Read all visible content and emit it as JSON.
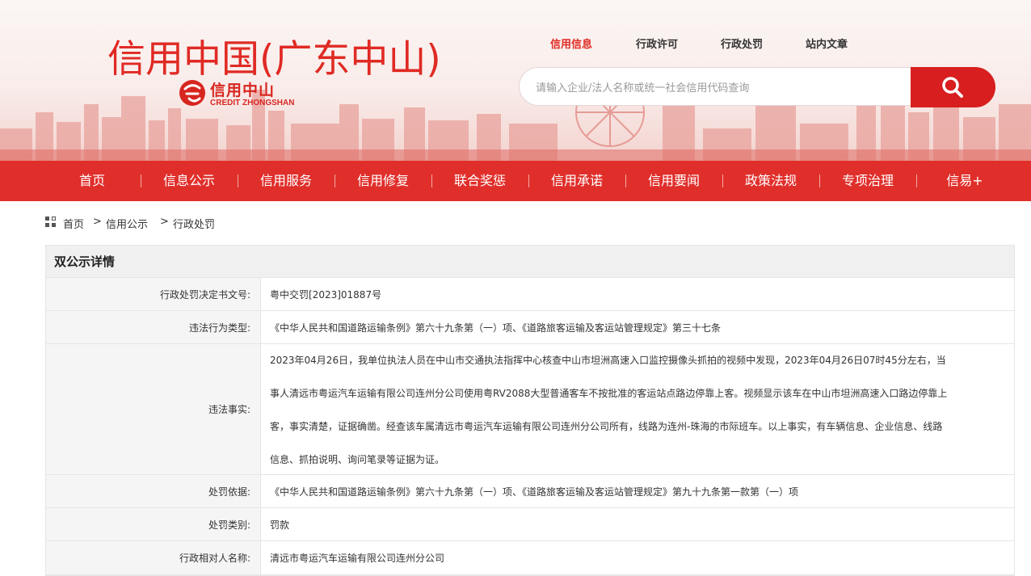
{
  "header": {
    "site_title": "信用中国(广东中山)",
    "logo_cn": "信用中山",
    "logo_en": "CREDIT ZHONGSHAN",
    "top_links": [
      {
        "label": "信用信息",
        "active": true
      },
      {
        "label": "行政许可",
        "active": false
      },
      {
        "label": "行政处罚",
        "active": false
      },
      {
        "label": "站内文章",
        "active": false
      }
    ],
    "search": {
      "placeholder": "请输入企业/法人名称或统一社会信用代码查询",
      "button_icon": "search-icon"
    }
  },
  "nav": {
    "items": [
      "首页",
      "信息公示",
      "信用服务",
      "信用修复",
      "联合奖惩",
      "信用承诺",
      "信用要闻",
      "政策法规",
      "专项治理",
      "信易+"
    ]
  },
  "breadcrumb": {
    "icon": "grid-icon",
    "parts": [
      "首页",
      ">",
      "信用公示",
      ">",
      "行政处罚"
    ]
  },
  "detail": {
    "title": "双公示详情",
    "rows": [
      {
        "label": "行政处罚决定书文号:",
        "value": "粤中交罚[2023]01887号"
      },
      {
        "label": "违法行为类型:",
        "value": "《中华人民共和国道路运输条例》第六十九条第（一）项、《道路旅客运输及客运站管理规定》第三十七条"
      },
      {
        "label": "违法事实:",
        "value_lines": [
          "2023年04月26日，我单位执法人员在中山市交通执法指挥中心核查中山市坦洲高速入口监控摄像头抓拍的视频中发现，2023年04月26日07时45分左右，当",
          "事人清远市粤运汽车运输有限公司连州分公司使用粤RV2088大型普通客车不按批准的客运站点路边停靠上客。视频显示该车在中山市坦洲高速入口路边停靠上",
          "客，事实清楚，证据确凿。经查该车属清远市粤运汽车运输有限公司连州分公司所有，线路为连州-珠海的市际班车。以上事实，有车辆信息、企业信息、线路",
          "信息、抓拍说明、询问笔录等证据为证。"
        ]
      },
      {
        "label": "处罚依据:",
        "value": "《中华人民共和国道路运输条例》第六十九条第（一）项、《道路旅客运输及客运站管理规定》第九十九条第一款第（一）项"
      },
      {
        "label": "处罚类别:",
        "value": "罚款"
      },
      {
        "label": "行政相对人名称:",
        "value": "清远市粤运汽车运输有限公司连州分公司"
      }
    ]
  },
  "colors": {
    "brand_red": "#e02f2b",
    "title_red": "#e02a24",
    "search_button": "#d81e1e"
  }
}
